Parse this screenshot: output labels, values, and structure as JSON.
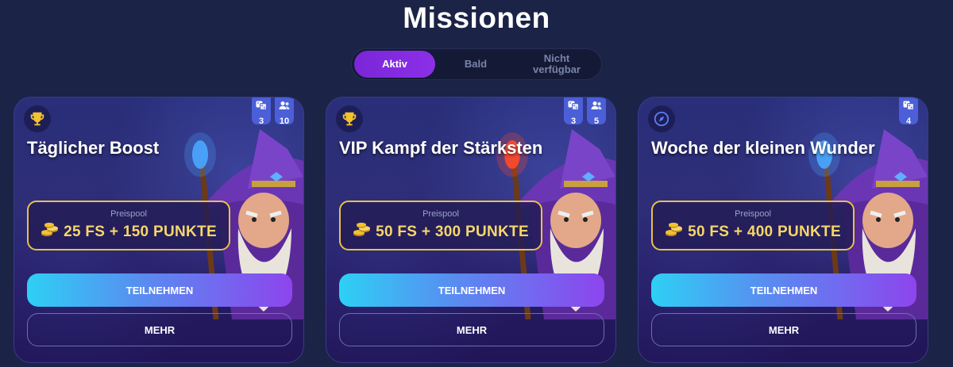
{
  "page": {
    "title": "Missionen"
  },
  "tabs": [
    {
      "label": "Aktiv",
      "active": true
    },
    {
      "label": "Bald",
      "active": false
    },
    {
      "label": "Nicht\nverfügbar",
      "active": false
    }
  ],
  "cards": [
    {
      "icon": "trophy-icon",
      "badges": [
        {
          "icon": "dice-icon",
          "value": "3"
        },
        {
          "icon": "users-icon",
          "value": "10"
        }
      ],
      "title": "Täglicher Boost",
      "prize_label": "Preispool",
      "prize_value": "25 FS + 150 PUNKTE",
      "join_label": "TEILNEHMEN",
      "more_label": "MEHR",
      "staff_color": "#4aa8ff"
    },
    {
      "icon": "trophy-icon",
      "badges": [
        {
          "icon": "dice-icon",
          "value": "3"
        },
        {
          "icon": "users-icon",
          "value": "5"
        }
      ],
      "title": "VIP Kampf der Stärksten",
      "prize_label": "Preispool",
      "prize_value": "50 FS + 300 PUNKTE",
      "join_label": "TEILNEHMEN",
      "more_label": "MEHR",
      "staff_color": "#ff4a2a"
    },
    {
      "icon": "compass-icon",
      "badges": [
        {
          "icon": "dice-icon",
          "value": "4"
        }
      ],
      "title": "Woche der kleinen Wunder",
      "prize_label": "Preispool",
      "prize_value": "50 FS + 400 PUNKTE",
      "join_label": "TEILNEHMEN",
      "more_label": "MEHR",
      "staff_color": "#4aa8ff"
    }
  ],
  "colors": {
    "background": "#1b2347",
    "tab_active": "#7a26d8",
    "prize_border": "#e7c14a",
    "prize_text": "#f6d768",
    "badge": "#4b5fd8"
  }
}
